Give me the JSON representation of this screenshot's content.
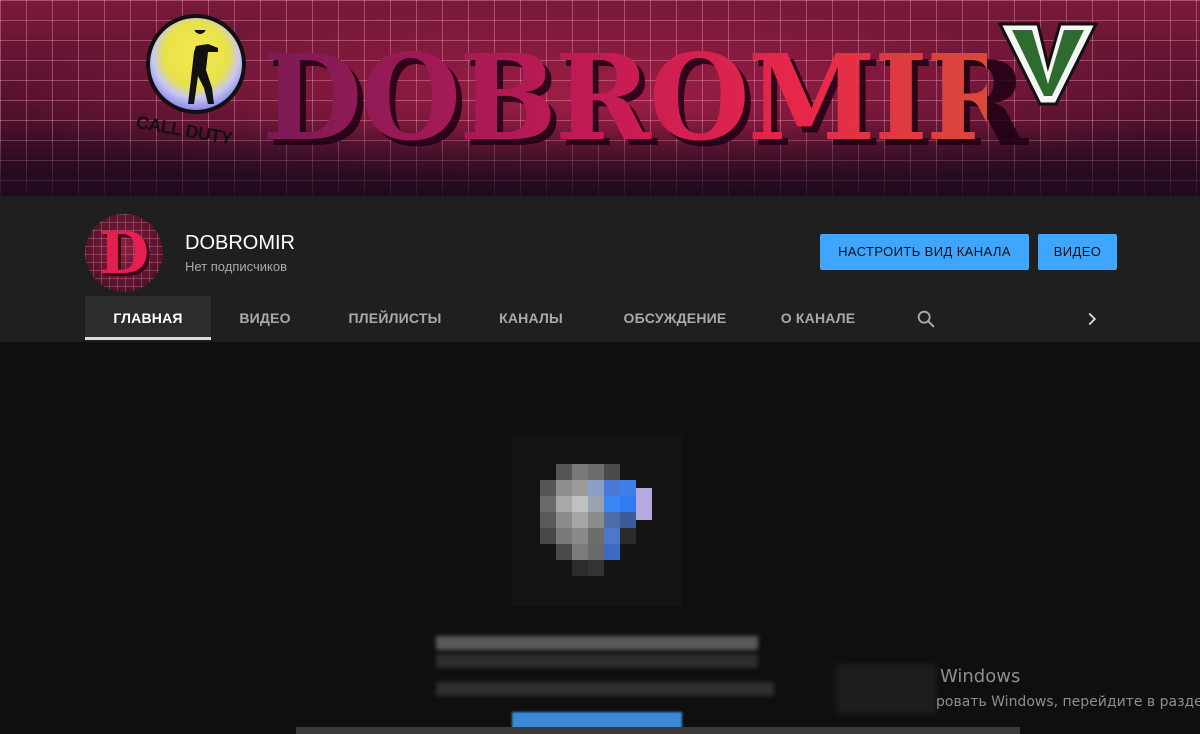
{
  "banner": {
    "title": "DOBROMIR",
    "left_logo_text": "CALL DUTY",
    "right_logo_text": "V"
  },
  "channel": {
    "avatar_letter": "D",
    "name": "DOBROMIR",
    "subscribers": "Нет подписчиков",
    "customize_button": "НАСТРОИТЬ ВИД КАНАЛА",
    "videos_button": "ВИДЕО"
  },
  "tabs": [
    {
      "label": "ГЛАВНАЯ",
      "active": true
    },
    {
      "label": "ВИДЕО",
      "active": false
    },
    {
      "label": "ПЛЕЙЛИСТЫ",
      "active": false
    },
    {
      "label": "КАНАЛЫ",
      "active": false
    },
    {
      "label": "ОБСУЖДЕНИЕ",
      "active": false
    },
    {
      "label": "О КАНАЛЕ",
      "active": false
    }
  ],
  "icons": {
    "search": "search-icon",
    "next": "chevron-right-icon"
  },
  "watermark": {
    "title": "Windows",
    "subtitle": "ровать Windows, перейдите в раздел \"П"
  },
  "colors": {
    "accent": "#3ea6ff",
    "header_bg": "#1f1f1f",
    "page_bg": "#0f0f0f"
  }
}
